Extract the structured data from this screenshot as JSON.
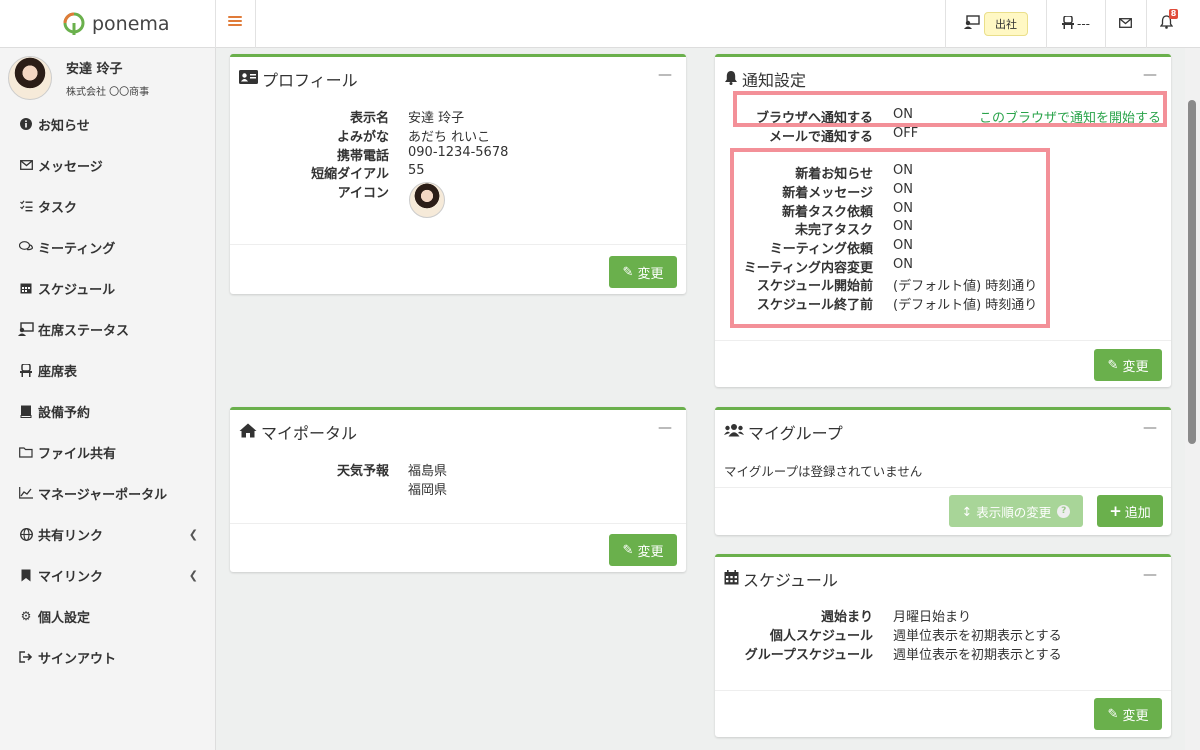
{
  "app": {
    "name": "ponema",
    "brand_color": "#6ab04c",
    "accent_color": "#e07b39"
  },
  "header": {
    "attendance_status": "出社",
    "seat_label": "---",
    "notification_count": "8",
    "icons": [
      "presence-icon",
      "seat-icon",
      "mail-icon",
      "bell-icon"
    ]
  },
  "user": {
    "name": "安達 玲子",
    "company": "株式会社 〇〇商事"
  },
  "sidebar": {
    "items": [
      {
        "label": "お知らせ",
        "icon": "info-icon"
      },
      {
        "label": "メッセージ",
        "icon": "envelope-icon"
      },
      {
        "label": "タスク",
        "icon": "tasks-icon"
      },
      {
        "label": "ミーティング",
        "icon": "comments-icon"
      },
      {
        "label": "スケジュール",
        "icon": "calendar-icon"
      },
      {
        "label": "在席ステータス",
        "icon": "presence-icon"
      },
      {
        "label": "座席表",
        "icon": "chair-icon"
      },
      {
        "label": "設備予約",
        "icon": "book-icon"
      },
      {
        "label": "ファイル共有",
        "icon": "folder-icon"
      },
      {
        "label": "マネージャーポータル",
        "icon": "chart-icon"
      },
      {
        "label": "共有リンク",
        "icon": "globe-icon",
        "expandable": true
      },
      {
        "label": "マイリンク",
        "icon": "bookmark-icon",
        "expandable": true
      },
      {
        "label": "個人設定",
        "icon": "gear-icon"
      },
      {
        "label": "サインアウト",
        "icon": "signout-icon"
      }
    ]
  },
  "profile": {
    "title": "プロフィール",
    "fields": [
      {
        "label": "表示名",
        "value": "安達 玲子"
      },
      {
        "label": "よみがな",
        "value": "あだち れいこ"
      },
      {
        "label": "携帯電話",
        "value": "090-1234-5678"
      },
      {
        "label": "短縮ダイアル",
        "value": "55"
      },
      {
        "label": "アイコン",
        "value": ""
      }
    ],
    "edit_label": "変更"
  },
  "notification_settings": {
    "title": "通知設定",
    "browser": {
      "label": "ブラウザへ通知する",
      "value": "ON",
      "link": "このブラウザで通知を開始する"
    },
    "mail": {
      "label": "メールで通知する",
      "value": "OFF"
    },
    "items": [
      {
        "label": "新着お知らせ",
        "value": "ON"
      },
      {
        "label": "新着メッセージ",
        "value": "ON"
      },
      {
        "label": "新着タスク依頼",
        "value": "ON"
      },
      {
        "label": "未完了タスク",
        "value": "ON"
      },
      {
        "label": "ミーティング依頼",
        "value": "ON"
      },
      {
        "label": "ミーティング内容変更",
        "value": "ON"
      },
      {
        "label": "スケジュール開始前",
        "value": "(デフォルト値) 時刻通り"
      },
      {
        "label": "スケジュール終了前",
        "value": "(デフォルト値) 時刻通り"
      }
    ],
    "edit_label": "変更",
    "highlight_color": "#f39098"
  },
  "my_portal": {
    "title": "マイポータル",
    "weather_label": "天気予報",
    "weather_values": [
      "福島県",
      "福岡県"
    ],
    "edit_label": "変更"
  },
  "my_group": {
    "title": "マイグループ",
    "empty_message": "マイグループは登録されていません",
    "reorder_label": "表示順の変更",
    "add_label": "追加"
  },
  "schedule": {
    "title": "スケジュール",
    "fields": [
      {
        "label": "週始まり",
        "value": "月曜日始まり"
      },
      {
        "label": "個人スケジュール",
        "value": "週単位表示を初期表示とする"
      },
      {
        "label": "グループスケジュール",
        "value": "週単位表示を初期表示とする"
      }
    ],
    "edit_label": "変更"
  }
}
